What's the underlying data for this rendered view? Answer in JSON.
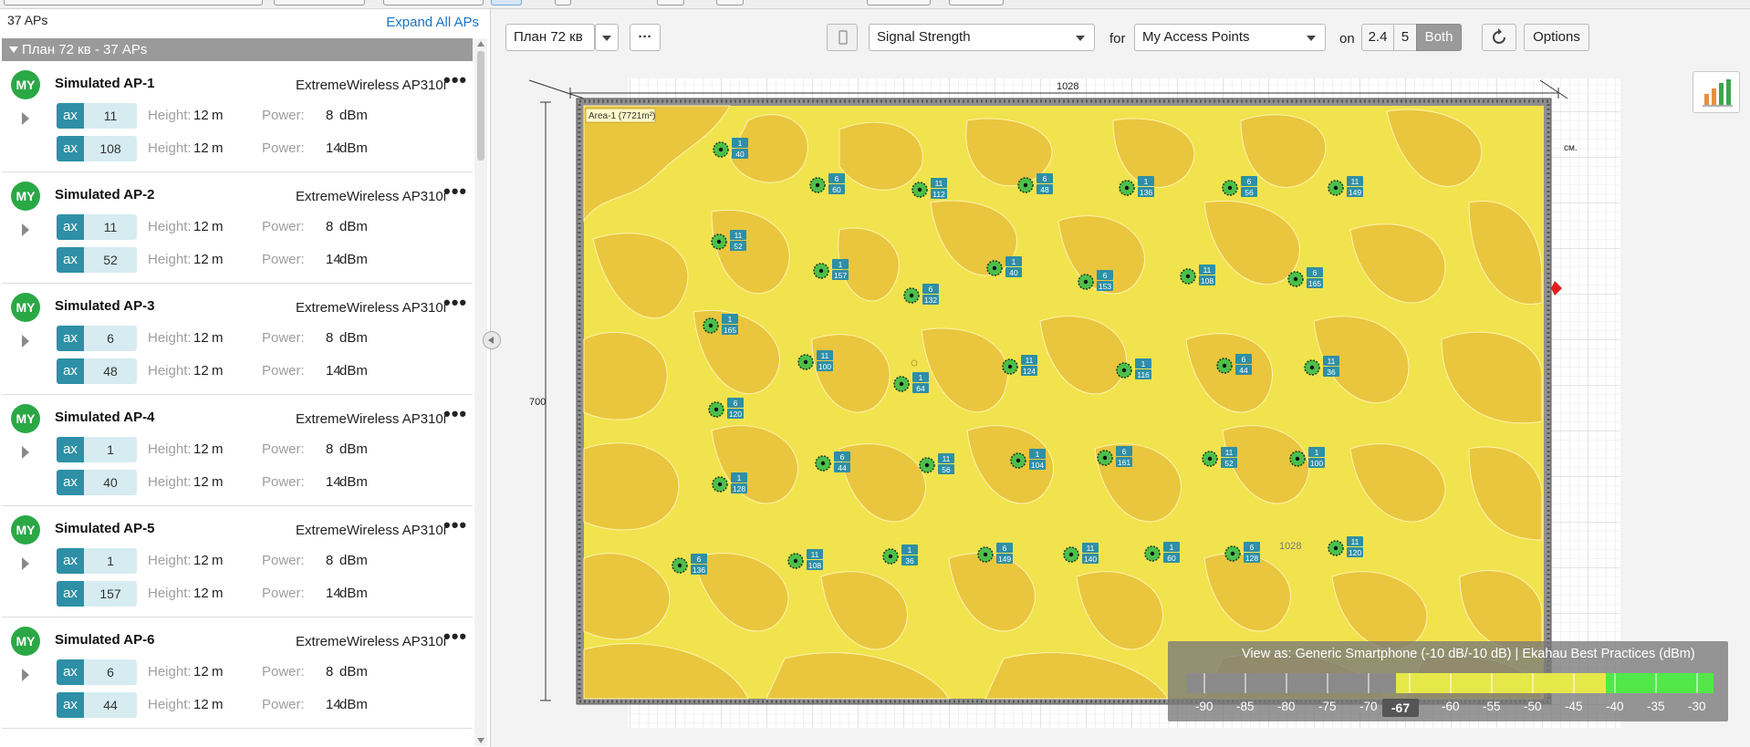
{
  "left": {
    "ap_count": "37 APs",
    "expand_all": "Expand All APs",
    "group_name": "План 72 кв - 37 APs",
    "field_labels": {
      "height": "Height:",
      "power": "Power:"
    },
    "units": {
      "height": "m",
      "power": "dBm"
    },
    "aps": [
      {
        "badge": "MY",
        "name": "Simulated AP-1",
        "model": "ExtremeWireless AP310i",
        "menu": "•••",
        "radios": [
          {
            "proto": "ax",
            "channel": "11",
            "height": "12",
            "power": "8"
          },
          {
            "proto": "ax",
            "channel": "108",
            "height": "12",
            "power": "14"
          }
        ]
      },
      {
        "badge": "MY",
        "name": "Simulated AP-2",
        "model": "ExtremeWireless AP310i",
        "menu": "•••",
        "radios": [
          {
            "proto": "ax",
            "channel": "11",
            "height": "12",
            "power": "8"
          },
          {
            "proto": "ax",
            "channel": "52",
            "height": "12",
            "power": "14"
          }
        ]
      },
      {
        "badge": "MY",
        "name": "Simulated AP-3",
        "model": "ExtremeWireless AP310i",
        "menu": "•••",
        "radios": [
          {
            "proto": "ax",
            "channel": "6",
            "height": "12",
            "power": "8"
          },
          {
            "proto": "ax",
            "channel": "48",
            "height": "12",
            "power": "14"
          }
        ]
      },
      {
        "badge": "MY",
        "name": "Simulated AP-4",
        "model": "ExtremeWireless AP310i",
        "menu": "•••",
        "radios": [
          {
            "proto": "ax",
            "channel": "1",
            "height": "12",
            "power": "8"
          },
          {
            "proto": "ax",
            "channel": "40",
            "height": "12",
            "power": "14"
          }
        ]
      },
      {
        "badge": "MY",
        "name": "Simulated AP-5",
        "model": "ExtremeWireless AP310i",
        "menu": "•••",
        "radios": [
          {
            "proto": "ax",
            "channel": "1",
            "height": "12",
            "power": "8"
          },
          {
            "proto": "ax",
            "channel": "157",
            "height": "12",
            "power": "14"
          }
        ]
      },
      {
        "badge": "MY",
        "name": "Simulated AP-6",
        "model": "ExtremeWireless AP310i",
        "menu": "•••",
        "radios": [
          {
            "proto": "ax",
            "channel": "6",
            "height": "12",
            "power": "8"
          },
          {
            "proto": "ax",
            "channel": "44",
            "height": "12",
            "power": "14"
          }
        ]
      }
    ]
  },
  "toolbar": {
    "floor_plan": "План 72 кв",
    "more": "···",
    "visualization": "Signal Strength",
    "for_label": "for",
    "target": "My Access Points",
    "on_label": "on",
    "bands": [
      "2.4",
      "5",
      "Both"
    ],
    "active_band": "Both",
    "options": "Options"
  },
  "map": {
    "width_dim": "1028",
    "height_dim": "700",
    "area_label": "Area-1 (7721m²)",
    "side_label": "см.",
    "bottom_dim": "1028",
    "ap_markers": [
      {
        "c1": "1",
        "c2": "40"
      },
      {
        "c1": "6",
        "c2": "60"
      },
      {
        "c1": "11",
        "c2": "112"
      },
      {
        "c1": "6",
        "c2": "48"
      },
      {
        "c1": "1",
        "c2": "136"
      },
      {
        "c1": "6",
        "c2": "56"
      },
      {
        "c1": "11",
        "c2": "149"
      },
      {
        "c1": "11",
        "c2": "52"
      },
      {
        "c1": "1",
        "c2": "157"
      },
      {
        "c1": "6",
        "c2": "132"
      },
      {
        "c1": "1",
        "c2": "40"
      },
      {
        "c1": "6",
        "c2": "153"
      },
      {
        "c1": "11",
        "c2": "108"
      },
      {
        "c1": "6",
        "c2": "165"
      },
      {
        "c1": "1",
        "c2": "165"
      },
      {
        "c1": "11",
        "c2": "100"
      },
      {
        "c1": "1",
        "c2": "64"
      },
      {
        "c1": "11",
        "c2": "124"
      },
      {
        "c1": "1",
        "c2": "116"
      },
      {
        "c1": "6",
        "c2": "44"
      },
      {
        "c1": "11",
        "c2": "36"
      },
      {
        "c1": "6",
        "c2": "120"
      },
      {
        "c1": "6",
        "c2": "44"
      },
      {
        "c1": "11",
        "c2": "56"
      },
      {
        "c1": "1",
        "c2": "104"
      },
      {
        "c1": "6",
        "c2": "161"
      },
      {
        "c1": "11",
        "c2": "52"
      },
      {
        "c1": "1",
        "c2": "100"
      },
      {
        "c1": "1",
        "c2": "128"
      },
      {
        "c1": "6",
        "c2": "136"
      },
      {
        "c1": "11",
        "c2": "108"
      },
      {
        "c1": "1",
        "c2": "36"
      },
      {
        "c1": "6",
        "c2": "149"
      },
      {
        "c1": "11",
        "c2": "140"
      },
      {
        "c1": "1",
        "c2": "60"
      },
      {
        "c1": "6",
        "c2": "128"
      },
      {
        "c1": "11",
        "c2": "120"
      }
    ]
  },
  "legend": {
    "title": "View as: Generic Smartphone (-10 dB/-10 dB)  |  Ekahau Best Practices (dBm)",
    "ticks": [
      "-90",
      "-85",
      "-80",
      "-75",
      "-70",
      "-65",
      "-60",
      "-55",
      "-50",
      "-45",
      "-40",
      "-35",
      "-30"
    ],
    "threshold": "-67",
    "colors": {
      "below": "#8a8a8a",
      "above": "#f1e54a",
      "strong": "#52e84a"
    }
  },
  "colors": {
    "accent": "#2e8fa6",
    "badge": "#2aa845",
    "link": "#1a73c7",
    "heatmap_fill": "#f1e34d",
    "heatmap_dark": "#e9c63e"
  }
}
